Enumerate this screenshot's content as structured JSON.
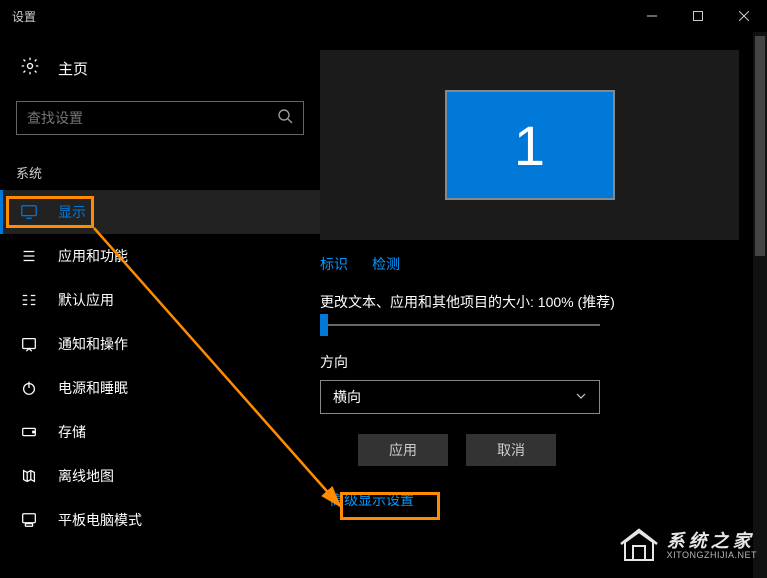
{
  "titlebar": {
    "title": "设置"
  },
  "sidebar": {
    "home": "主页",
    "search_placeholder": "查找设置",
    "section": "系统",
    "items": [
      {
        "label": "显示"
      },
      {
        "label": "应用和功能"
      },
      {
        "label": "默认应用"
      },
      {
        "label": "通知和操作"
      },
      {
        "label": "电源和睡眠"
      },
      {
        "label": "存储"
      },
      {
        "label": "离线地图"
      },
      {
        "label": "平板电脑模式"
      }
    ]
  },
  "main": {
    "monitor_number": "1",
    "identify": "标识",
    "detect": "检测",
    "scale_label": "更改文本、应用和其他项目的大小: 100% (推荐)",
    "orientation_label": "方向",
    "orientation_value": "横向",
    "apply": "应用",
    "cancel": "取消",
    "advanced": "高级显示设置"
  },
  "watermark": {
    "cn": "系统之家",
    "en": "XITONGZHIJIA.NET"
  }
}
